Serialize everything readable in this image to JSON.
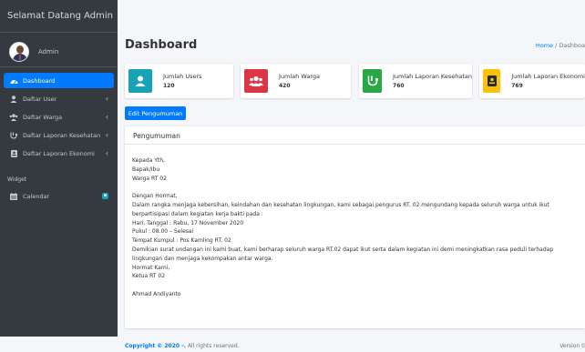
{
  "brand": "Selamat Datang Admin",
  "user": {
    "name": "Admin"
  },
  "sidebar": {
    "items": [
      {
        "label": "Dashboard",
        "icon": "dashboard-icon"
      },
      {
        "label": "Daftar User",
        "icon": "user-icon"
      },
      {
        "label": "Daftar Warga",
        "icon": "users-icon"
      },
      {
        "label": "Daftar Laporan Kesehatan",
        "icon": "stethoscope-icon"
      },
      {
        "label": "Daftar Laporan Ekonomi",
        "icon": "id-card-icon"
      }
    ],
    "widget_header": "Widget",
    "calendar": {
      "label": "Calendar",
      "icon": "calendar-icon"
    }
  },
  "header": {
    "title": "Dashboard",
    "breadcrumb_home": "Home",
    "breadcrumb_current": "Dashboa"
  },
  "info_boxes": [
    {
      "label": "Jumlah Users",
      "value": "120",
      "color": "#17a2b8",
      "icon": "user-icon"
    },
    {
      "label": "Jumlah Warga",
      "value": "420",
      "color": "#dc3545",
      "icon": "users-icon"
    },
    {
      "label": "Jumlah Laporan Kesehatan",
      "value": "760",
      "color": "#28a745",
      "icon": "stethoscope-icon"
    },
    {
      "label": "Jumlah Laporan Ekonomi",
      "value": "769",
      "color": "#ffc107",
      "icon": "id-card-icon"
    }
  ],
  "edit_button": "Edit Pengumuman",
  "announcement": {
    "title": "Pengumuman",
    "lines": [
      "Kepada Yth,",
      "Bapak/Ibu",
      "Warga RT 02",
      "",
      "Dengan Hormat,",
      "Dalam rangka menjaga kebersihan, keindahan dan kesehatan lingkungan, kami sebagai pengurus RT. 02 mengundang kepada seluruh warga untuk ikut",
      "berpartisipasi dalam kegiatan kerja bakti pada :",
      "Hari, Tanggal : Rabu, 17 November 2020",
      "Pukul : 08.00 – Selesai",
      "Tempat Kumpul : Pos Kamling RT. 02",
      "Demikian surat undangan ini kami buat, kami berharap seluruh warga RT.02 dapat ikut serta dalam kegiatan ini demi meningkatkan rasa peduli terhadap",
      "lingkungan dan menjaga kekompakan antar warga.",
      "Hormat Kami,",
      "Ketua RT 02",
      "",
      "Ahmad Andiyanto"
    ]
  },
  "footer": {
    "copyright": "Copyright © 2020 -.",
    "rights": " All rights reserved.",
    "version": "Version 0"
  },
  "colors": {
    "sidebar": "#343a40",
    "active": "#007bff"
  }
}
